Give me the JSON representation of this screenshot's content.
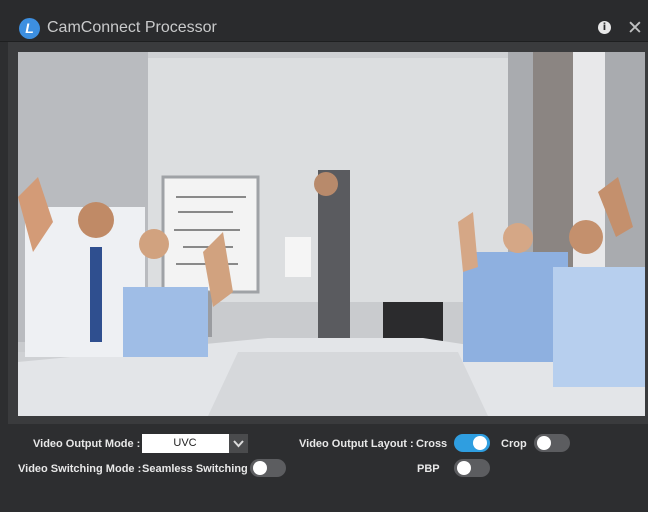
{
  "app": {
    "title": "CamConnect Processor",
    "logo_letter": "L"
  },
  "titlebar": {
    "info_icon": "info-icon",
    "close_icon": "close-icon"
  },
  "controls": {
    "output_mode": {
      "label": "Video Output Mode :",
      "value": "UVC",
      "dropdown_icon": "chevron-down-icon"
    },
    "output_layout": {
      "label": "Video Output Layout :"
    },
    "cross": {
      "label": "Cross",
      "on": true
    },
    "crop": {
      "label": "Crop",
      "on": false
    },
    "pbp": {
      "label": "PBP",
      "on": false
    },
    "switching_mode": {
      "label": "Video Switching Mode :",
      "value_label": "Seamless Switching",
      "on": false
    }
  },
  "colors": {
    "accent": "#2f9ee0",
    "background": "#2d2e30"
  }
}
